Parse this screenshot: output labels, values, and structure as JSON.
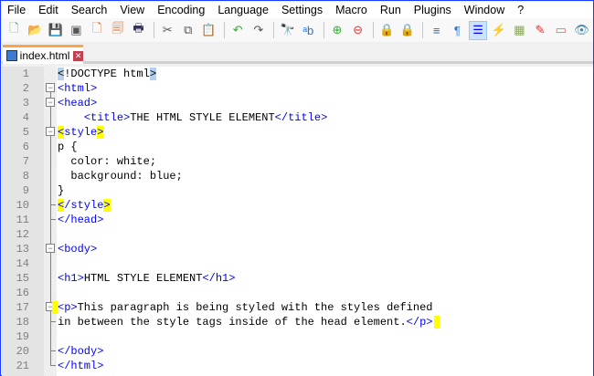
{
  "menu": [
    "File",
    "Edit",
    "Search",
    "View",
    "Encoding",
    "Language",
    "Settings",
    "Macro",
    "Run",
    "Plugins",
    "Window",
    "?"
  ],
  "toolbar": [
    {
      "icon": "new-file-icon",
      "glyph": "🗋",
      "color": "#6a6"
    },
    {
      "icon": "open-file-icon",
      "glyph": "📂",
      "color": "#e0a020"
    },
    {
      "icon": "save-icon",
      "glyph": "💾",
      "color": "#666"
    },
    {
      "icon": "save-all-icon",
      "glyph": "▣",
      "color": "#555"
    },
    {
      "icon": "close-icon",
      "glyph": "🗋",
      "color": "#e06020"
    },
    {
      "icon": "close-all-icon",
      "glyph": "🗐",
      "color": "#e06020"
    },
    {
      "icon": "print-icon",
      "glyph": "🖶",
      "color": "#335"
    },
    {
      "sep": true
    },
    {
      "icon": "cut-icon",
      "glyph": "✂",
      "color": "#555"
    },
    {
      "icon": "copy-icon",
      "glyph": "⧉",
      "color": "#555"
    },
    {
      "icon": "paste-icon",
      "glyph": "📋",
      "color": "#b07030"
    },
    {
      "sep": true
    },
    {
      "icon": "undo-icon",
      "glyph": "↶",
      "color": "#3a3"
    },
    {
      "icon": "redo-icon",
      "glyph": "↷",
      "color": "#555"
    },
    {
      "sep": true
    },
    {
      "icon": "find-icon",
      "glyph": "🔭",
      "color": "#333"
    },
    {
      "icon": "replace-icon",
      "glyph": "ᵃb",
      "color": "#27c"
    },
    {
      "sep": true
    },
    {
      "icon": "zoom-in-icon",
      "glyph": "⊕",
      "color": "#3a3"
    },
    {
      "icon": "zoom-out-icon",
      "glyph": "⊖",
      "color": "#d33"
    },
    {
      "sep": true
    },
    {
      "icon": "sync-vertical-icon",
      "glyph": "🔒",
      "color": "#d0a020"
    },
    {
      "icon": "sync-horizontal-icon",
      "glyph": "🔒",
      "color": "#d0a020"
    },
    {
      "sep": true
    },
    {
      "icon": "word-wrap-icon",
      "glyph": "≡",
      "color": "#36a"
    },
    {
      "icon": "show-all-characters-icon",
      "glyph": "¶",
      "color": "#27c"
    },
    {
      "icon": "indent-guide-icon",
      "glyph": "☰",
      "color": "#00f",
      "active": true
    },
    {
      "icon": "user-language-icon",
      "glyph": "⚡",
      "color": "#d0a020"
    },
    {
      "icon": "document-map-icon",
      "glyph": "▦",
      "color": "#8a5"
    },
    {
      "icon": "function-list-icon",
      "glyph": "✎",
      "color": "#d33"
    },
    {
      "icon": "folder-as-workspace-icon",
      "glyph": "▭",
      "color": "#d66"
    },
    {
      "icon": "monitoring-icon",
      "glyph": "👁",
      "color": "#48a"
    }
  ],
  "tab": {
    "label": "index.html",
    "icon": "saved-file-icon",
    "close_icon": "close-tab-icon",
    "close_glyph": "✕"
  },
  "lines": [
    {
      "n": "1",
      "fold": "",
      "tokens": [
        {
          "c": "hb",
          "v": "<"
        },
        {
          "c": "",
          "v": "!DOCTYPE html"
        },
        {
          "c": "hb",
          "v": ">"
        }
      ]
    },
    {
      "n": "2",
      "fold": "box",
      "tokens": [
        {
          "c": "t",
          "v": "<html>"
        }
      ]
    },
    {
      "n": "3",
      "fold": "box",
      "tokens": [
        {
          "c": "t",
          "v": "<head>"
        }
      ]
    },
    {
      "n": "4",
      "fold": "v",
      "tokens": [
        {
          "c": "",
          "v": "    "
        },
        {
          "c": "t",
          "v": "<title>"
        },
        {
          "c": "",
          "v": "THE HTML STYLE ELEMENT"
        },
        {
          "c": "t",
          "v": "</title>"
        }
      ]
    },
    {
      "n": "5",
      "fold": "box",
      "tokens": [
        {
          "c": "t hy",
          "v": "<"
        },
        {
          "c": "t",
          "v": "style"
        },
        {
          "c": "t hy",
          "v": ">"
        }
      ]
    },
    {
      "n": "6",
      "fold": "v",
      "tokens": [
        {
          "c": "",
          "v": "p {"
        }
      ]
    },
    {
      "n": "7",
      "fold": "v",
      "tokens": [
        {
          "c": "",
          "v": "  color: white;"
        }
      ]
    },
    {
      "n": "8",
      "fold": "v",
      "tokens": [
        {
          "c": "",
          "v": "  background: blue;"
        }
      ]
    },
    {
      "n": "9",
      "fold": "v",
      "tokens": [
        {
          "c": "",
          "v": "}"
        }
      ]
    },
    {
      "n": "10",
      "fold": "end",
      "tokens": [
        {
          "c": "t hy",
          "v": "<"
        },
        {
          "c": "t",
          "v": "/style"
        },
        {
          "c": "t hy",
          "v": ">"
        }
      ]
    },
    {
      "n": "11",
      "fold": "end",
      "tokens": [
        {
          "c": "t",
          "v": "</head>"
        }
      ]
    },
    {
      "n": "12",
      "fold": "v",
      "tokens": []
    },
    {
      "n": "13",
      "fold": "box",
      "tokens": [
        {
          "c": "t",
          "v": "<body>"
        }
      ]
    },
    {
      "n": "14",
      "fold": "v",
      "tokens": []
    },
    {
      "n": "15",
      "fold": "v",
      "tokens": [
        {
          "c": "t",
          "v": "<h1>"
        },
        {
          "c": "",
          "v": "HTML STYLE ELEMENT"
        },
        {
          "c": "t",
          "v": "</h1>"
        }
      ]
    },
    {
      "n": "16",
      "fold": "v",
      "tokens": []
    },
    {
      "n": "17",
      "fold": "box",
      "pre": true,
      "tokens": [
        {
          "c": "t",
          "v": "<p>"
        },
        {
          "c": "",
          "v": "This paragraph is being styled with the styles defined"
        }
      ]
    },
    {
      "n": "18",
      "fold": "end",
      "post": true,
      "tokens": [
        {
          "c": "",
          "v": "in between the style tags inside of the head element."
        },
        {
          "c": "t",
          "v": "</p>"
        }
      ]
    },
    {
      "n": "19",
      "fold": "v",
      "tokens": []
    },
    {
      "n": "20",
      "fold": "end",
      "tokens": [
        {
          "c": "t",
          "v": "</body>"
        }
      ]
    },
    {
      "n": "21",
      "fold": "last",
      "tokens": [
        {
          "c": "t",
          "v": "</html>"
        }
      ]
    }
  ]
}
